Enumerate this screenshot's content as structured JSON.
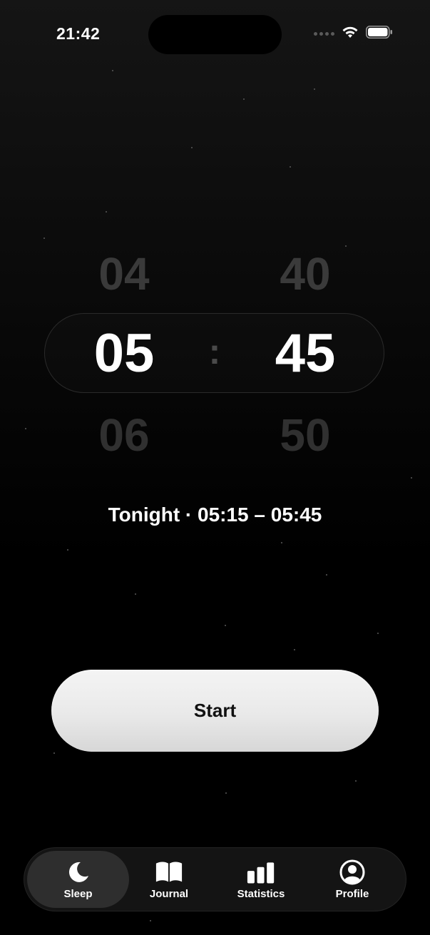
{
  "status_bar": {
    "time": "21:42"
  },
  "picker": {
    "hours": [
      "04",
      "05",
      "06"
    ],
    "minutes": [
      "40",
      "45",
      "50"
    ],
    "separator": ":"
  },
  "schedule": {
    "text": "Tonight · 05:15 – 05:45"
  },
  "start_button": {
    "label": "Start"
  },
  "tab_bar": {
    "tabs": [
      {
        "label": "Sleep",
        "icon": "moon-icon",
        "active": true
      },
      {
        "label": "Journal",
        "icon": "book-icon",
        "active": false
      },
      {
        "label": "Statistics",
        "icon": "bar-chart-icon",
        "active": false
      },
      {
        "label": "Profile",
        "icon": "profile-icon",
        "active": false
      }
    ]
  },
  "colors": {
    "background": "#000000",
    "start_button": "#ececec",
    "tab_bar": "#141414",
    "active_tab": "#2e2e2e"
  }
}
